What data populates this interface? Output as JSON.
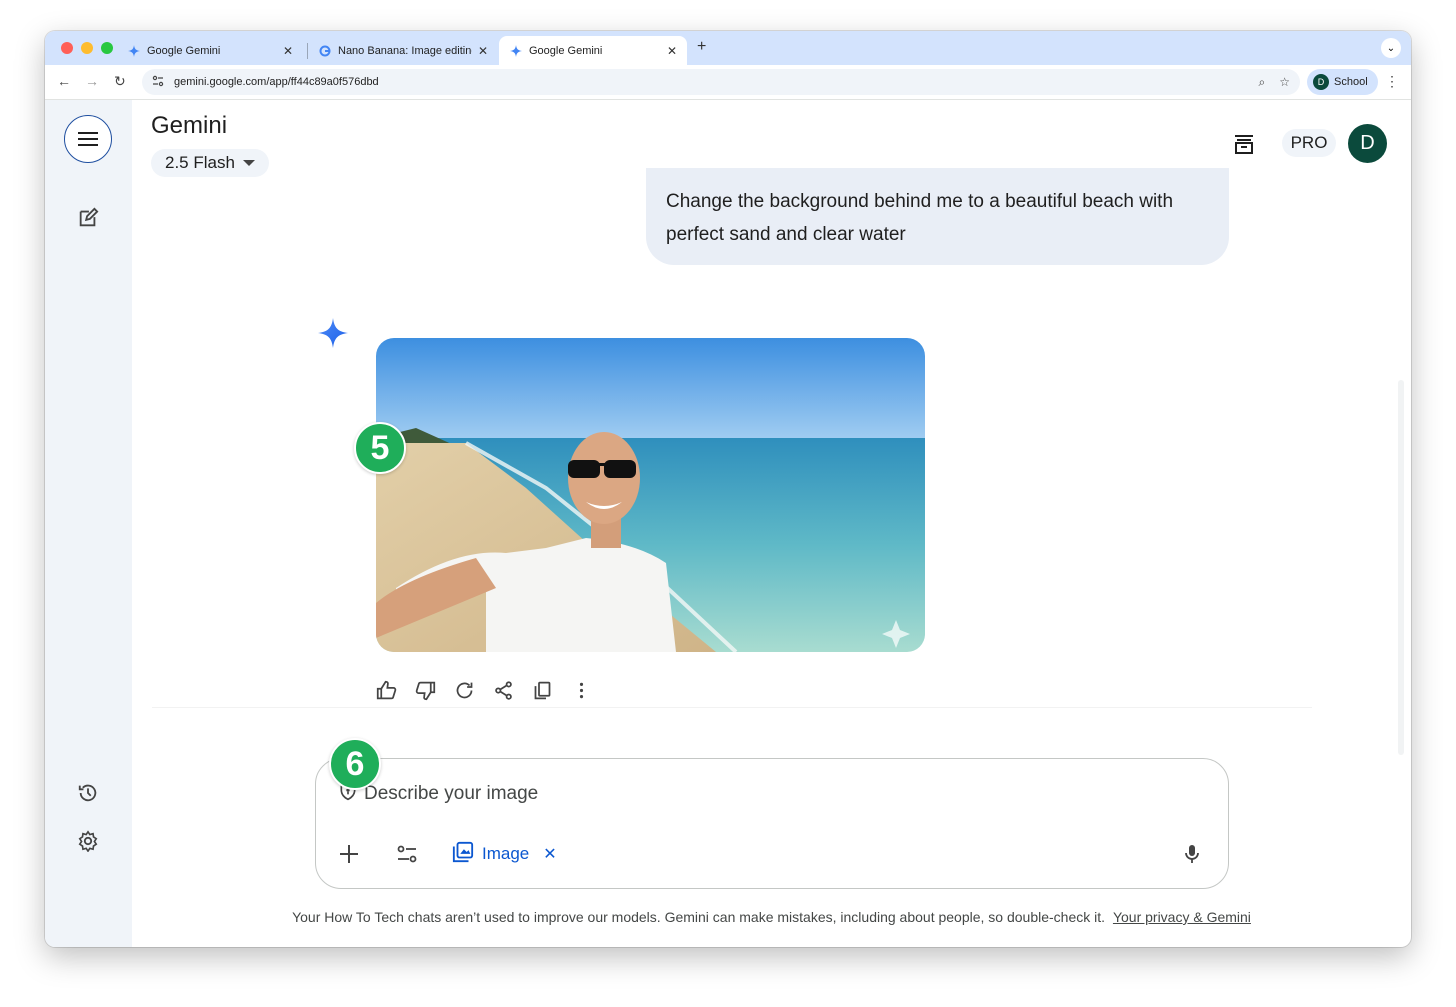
{
  "browser": {
    "tabs": [
      {
        "title": "Google Gemini",
        "icon": "gemini-icon",
        "active": false
      },
      {
        "title": "Nano Banana: Image editing i",
        "icon": "google-g-icon",
        "active": false
      },
      {
        "title": "Google Gemini",
        "icon": "gemini-icon",
        "active": true
      }
    ],
    "url": "gemini.google.com/app/ff44c89a0f576dbd",
    "profile_initial": "D",
    "profile_label": "School"
  },
  "app": {
    "title": "Gemini",
    "model": "2.5 Flash",
    "pro_label": "PRO",
    "avatar_initial": "D"
  },
  "conversation": {
    "user_message": "Change the background behind me to a beautiful beach with perfect sand and clear water",
    "response_image_description": "beach-selfie"
  },
  "badges": {
    "step5": "5",
    "step6": "6"
  },
  "composer": {
    "placeholder": "Describe your image",
    "image_chip_label": "Image"
  },
  "footer": {
    "disclaimer": "Your How To Tech chats aren’t used to improve our models. Gemini can make mistakes, including about people, so double-check it.",
    "privacy_link": "Your privacy & Gemini"
  },
  "colors": {
    "accent": "#0b57d0",
    "badge": "#1fae5a",
    "avatar": "#0b4a3c",
    "sidebar": "#f0f4f9"
  }
}
